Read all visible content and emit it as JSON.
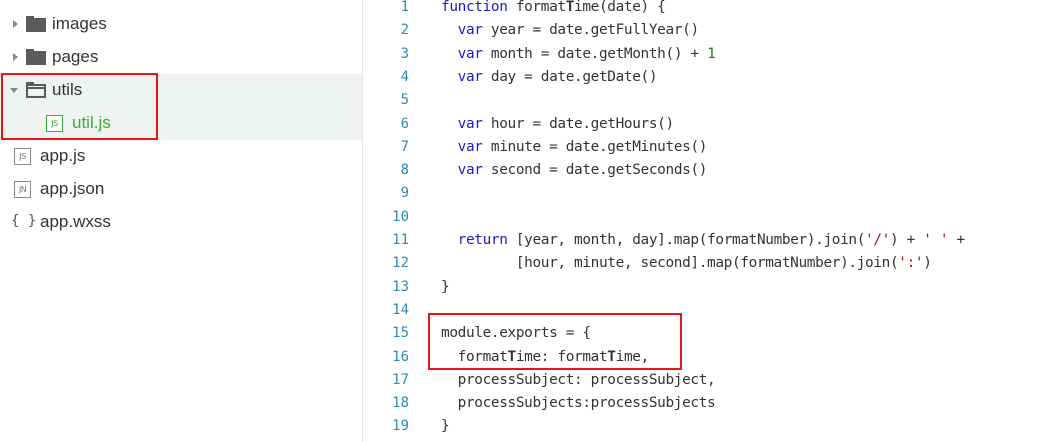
{
  "file_tree": {
    "items": [
      {
        "name": "images",
        "kind": "folder",
        "state": "collapsed"
      },
      {
        "name": "pages",
        "kind": "folder",
        "state": "collapsed"
      },
      {
        "name": "utils",
        "kind": "folder",
        "state": "expanded"
      },
      {
        "name": "util.js",
        "kind": "file",
        "icon": "JS",
        "selected": true
      },
      {
        "name": "app.js",
        "kind": "file",
        "icon": "JS"
      },
      {
        "name": "app.json",
        "kind": "file",
        "icon": "JN"
      },
      {
        "name": "app.wxss",
        "kind": "file",
        "icon": "{ }"
      }
    ]
  },
  "editor": {
    "lines": [
      {
        "n": "1",
        "text": "function formatTime(date) {"
      },
      {
        "n": "2",
        "text": "  var year = date.getFullYear()"
      },
      {
        "n": "3",
        "text": "  var month = date.getMonth() + 1"
      },
      {
        "n": "4",
        "text": "  var day = date.getDate()"
      },
      {
        "n": "5",
        "text": ""
      },
      {
        "n": "6",
        "text": "  var hour = date.getHours()"
      },
      {
        "n": "7",
        "text": "  var minute = date.getMinutes()"
      },
      {
        "n": "8",
        "text": "  var second = date.getSeconds()"
      },
      {
        "n": "9",
        "text": ""
      },
      {
        "n": "10",
        "text": ""
      },
      {
        "n": "11",
        "text": "  return [year, month, day].map(formatNumber).join('/') + ' ' +"
      },
      {
        "n": "12",
        "text": "         [hour, minute, second].map(formatNumber).join(':')"
      },
      {
        "n": "13",
        "text": "}"
      },
      {
        "n": "14",
        "text": ""
      },
      {
        "n": "15",
        "text": "module.exports = {"
      },
      {
        "n": "16",
        "text": "  formatTime: formatTime,"
      },
      {
        "n": "17",
        "text": "  processSubject: processSubject,"
      },
      {
        "n": "18",
        "text": "  processSubjects:processSubjects"
      },
      {
        "n": "19",
        "text": "}"
      }
    ]
  },
  "colors": {
    "keyword": "#1b1bcc",
    "line_number": "#2e8bb8",
    "highlight_box": "#e8141c",
    "selected_file": "#3aab3a"
  }
}
